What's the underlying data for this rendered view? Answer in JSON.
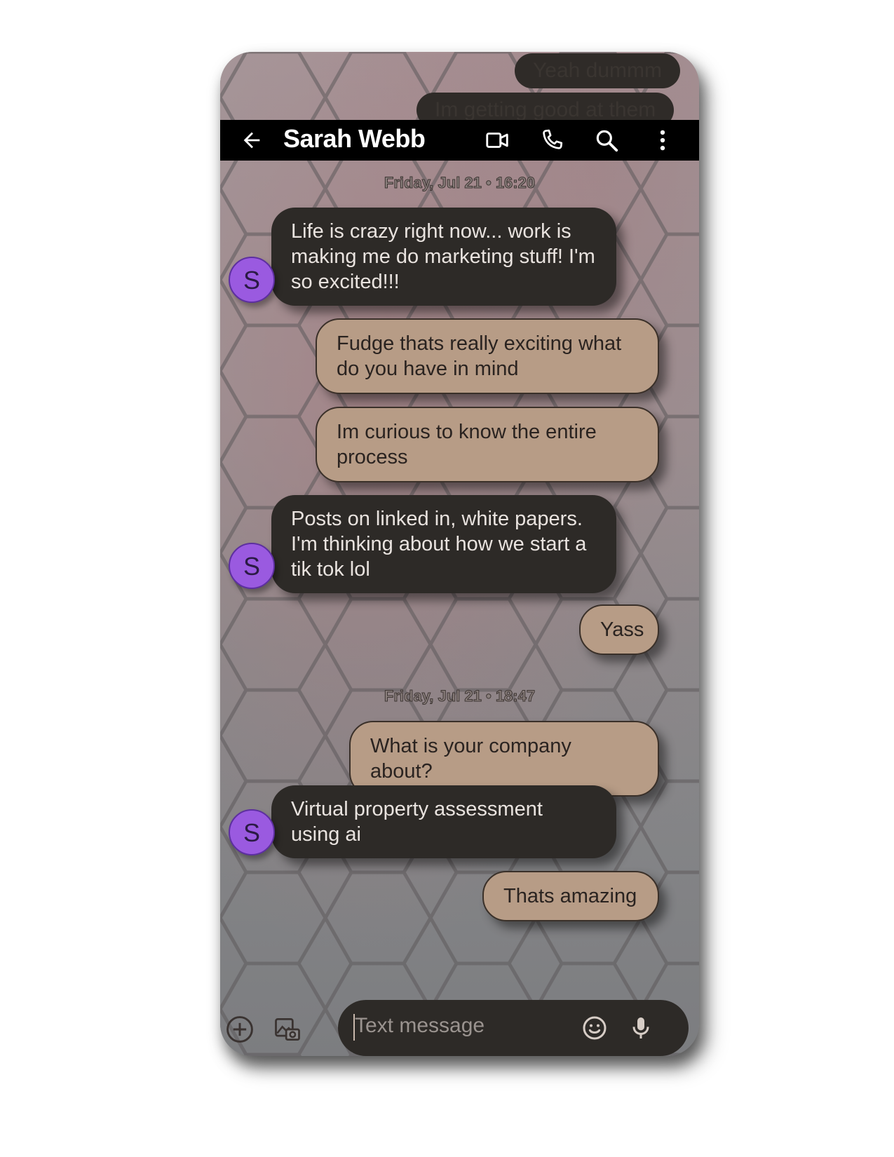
{
  "header": {
    "contact_name": "Sarah Webb"
  },
  "ghost_messages": [
    "Yeah dummm",
    "Im getting good at them"
  ],
  "messages": [
    {
      "type": "timestamp",
      "text": "Friday, Jul 21 • 16:20"
    },
    {
      "type": "incoming",
      "avatar": "S",
      "text": "Life is crazy right now... work is making me do marketing stuff! I'm so excited!!!"
    },
    {
      "type": "outgoing",
      "text": "Fudge thats really exciting what do you have in mind"
    },
    {
      "type": "outgoing",
      "text": "Im curious to know the entire process"
    },
    {
      "type": "incoming",
      "avatar": "S",
      "text": "Posts on linked in, white papers. I'm thinking about how we start a tik tok lol"
    },
    {
      "type": "outgoing",
      "text": "Yass"
    },
    {
      "type": "timestamp",
      "text": "Friday, Jul 21 • 18:47"
    },
    {
      "type": "outgoing",
      "text": "What is your company about?"
    },
    {
      "type": "incoming",
      "avatar": "S",
      "text": "Virtual property assessment using ai"
    },
    {
      "type": "outgoing",
      "text": "Thats amazing"
    }
  ],
  "composer": {
    "placeholder": "Text message"
  },
  "icons": {
    "back": "arrow-left-icon",
    "video": "video-camera-icon",
    "call": "phone-icon",
    "search": "search-icon",
    "more": "more-vert-icon",
    "add": "add-circle-icon",
    "gallery": "gallery-camera-icon",
    "emoji": "emoji-icon",
    "mic": "mic-icon"
  },
  "colors": {
    "incoming_bubble": "#2d2a27",
    "outgoing_bubble": "#b79c86",
    "avatar": "#9a5ae0",
    "appbar": "#000000"
  }
}
